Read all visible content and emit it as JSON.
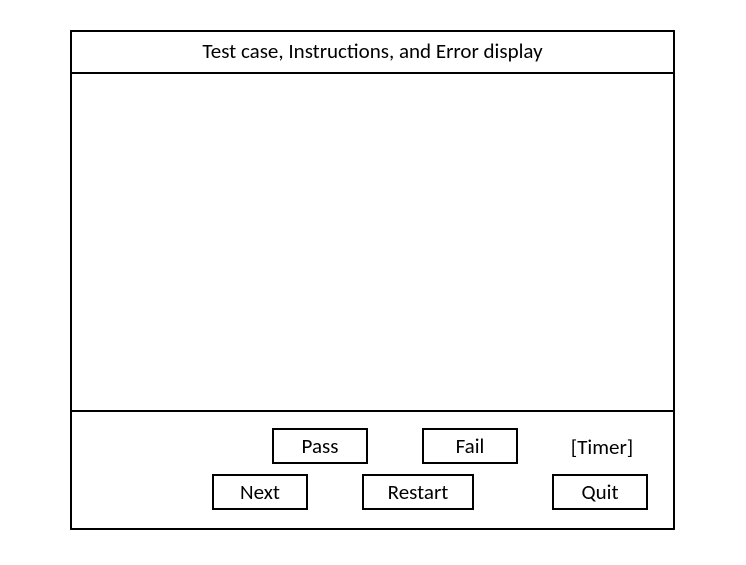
{
  "header": {
    "title": "Test case, Instructions, and Error display"
  },
  "footer": {
    "buttons": {
      "pass": "Pass",
      "fail": "Fail",
      "next": "Next",
      "restart": "Restart",
      "quit": "Quit"
    },
    "timer_label": "[Timer]"
  }
}
